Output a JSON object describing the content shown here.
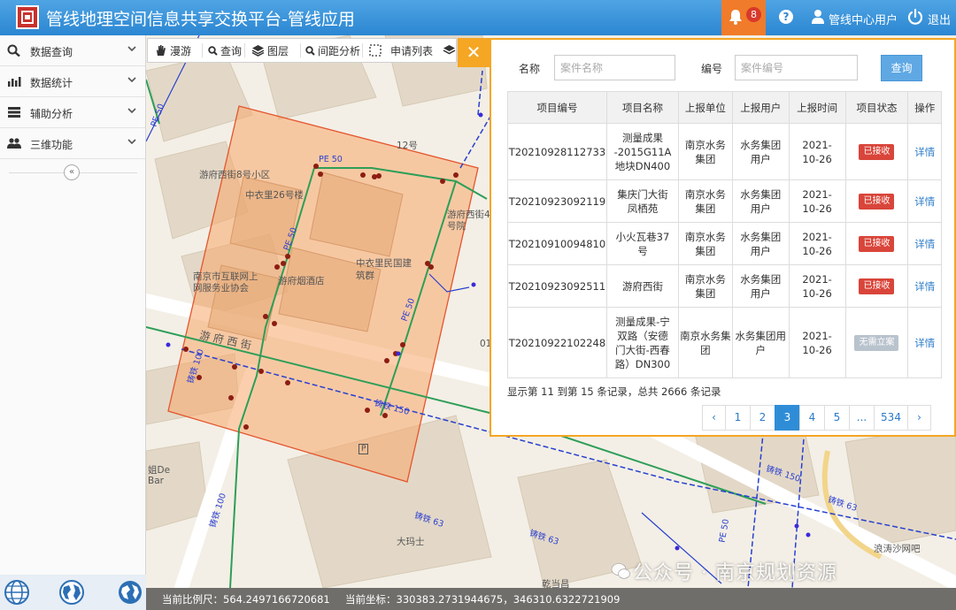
{
  "header": {
    "title": "管线地理空间信息共享交换平台-管线应用",
    "notification_count": "8",
    "help": "?",
    "user": "管线中心用户",
    "logout": "退出"
  },
  "sidebar": {
    "items": [
      {
        "label": "数据查询",
        "icon": "search-icon"
      },
      {
        "label": "数据统计",
        "icon": "bar-chart-icon"
      },
      {
        "label": "辅助分析",
        "icon": "list-icon"
      },
      {
        "label": "三维功能",
        "icon": "users-icon"
      }
    ],
    "collapse": "«"
  },
  "toolbar": {
    "roam": "漫游",
    "query": "查询",
    "layers": "图层",
    "distance": "间距分析",
    "apply_list": "申请列表",
    "close": "✕"
  },
  "panel": {
    "name_label": "名称",
    "name_placeholder": "案件名称",
    "number_label": "编号",
    "number_placeholder": "案件编号",
    "query_button": "查询",
    "columns": [
      "项目编号",
      "项目名称",
      "上报单位",
      "上报用户",
      "上报时间",
      "项目状态",
      "操作"
    ],
    "rows": [
      {
        "id": "T20210928112733",
        "name_lines": [
          "测量成果",
          "-2015G11A",
          "地块DN400"
        ],
        "unit_lines": [
          "南京水务",
          "集团"
        ],
        "user_lines": [
          "水务集团",
          "用户"
        ],
        "time_lines": [
          "2021-",
          "10-26"
        ],
        "status": "已接收",
        "status_color": "#d9453a",
        "action": "详情"
      },
      {
        "id": "T20210923092119",
        "name_lines": [
          "集庆门大街",
          "凤栖苑"
        ],
        "unit_lines": [
          "南京水务",
          "集团"
        ],
        "user_lines": [
          "水务集团",
          "用户"
        ],
        "time_lines": [
          "2021-",
          "10-26"
        ],
        "status": "已接收",
        "status_color": "#d9453a",
        "action": "详情"
      },
      {
        "id": "T20210910094810",
        "name_lines": [
          "小火瓦巷37",
          "号"
        ],
        "unit_lines": [
          "南京水务",
          "集团"
        ],
        "user_lines": [
          "水务集团",
          "用户"
        ],
        "time_lines": [
          "2021-",
          "10-26"
        ],
        "status": "已接收",
        "status_color": "#d9453a",
        "action": "详情"
      },
      {
        "id": "T20210923092511",
        "name_lines": [
          "游府西街"
        ],
        "unit_lines": [
          "南京水务",
          "集团"
        ],
        "user_lines": [
          "水务集团",
          "用户"
        ],
        "time_lines": [
          "2021-",
          "10-26"
        ],
        "status": "已接收",
        "status_color": "#d9453a",
        "action": "详情"
      },
      {
        "id": "T20210922102248",
        "name_lines": [
          "测量成果-宁",
          "双路（安德",
          "门大街-西春",
          "路）DN300"
        ],
        "unit_lines": [
          "南京水务集团"
        ],
        "user_lines": [
          "水务集团用户"
        ],
        "time_lines": [
          "2021-",
          "10-26"
        ],
        "status": "无需立案",
        "status_color": "#b9c3cd",
        "action": "详情"
      }
    ],
    "records_info": "显示第 11 到第 15 条记录，总共 2666 条记录",
    "pagination": [
      "‹",
      "1",
      "2",
      "3",
      "4",
      "5",
      "...",
      "534",
      "›"
    ],
    "active_page": "3"
  },
  "map": {
    "labels": [
      "游府西街8号小区",
      "中衣里26号楼",
      "12号",
      "游府西街4号院",
      "南京市互联网上网服务业协会",
      "游府烟酒店",
      "中衣里民国建筑群",
      "游 府 西 街",
      "大玛士",
      "乾当昌",
      "浪涛沙网吧",
      "姐De",
      "Bar",
      "01",
      "P"
    ],
    "pipe_labels": [
      "PE 50",
      "PE 50",
      "PE 50",
      "铸铁 150",
      "铸铁 63",
      "铸铁 63",
      "铸铁 100",
      "铸铁 100",
      "铸铁 150",
      "PE 50",
      "PE 50",
      "铸铁 63"
    ]
  },
  "status_bar": {
    "scale": "当前比例尺：564.2497166720681",
    "coords": "当前坐标：330383.2731944675，346310.6322721909"
  },
  "watermark": "公众号 · 南京规划资源"
}
